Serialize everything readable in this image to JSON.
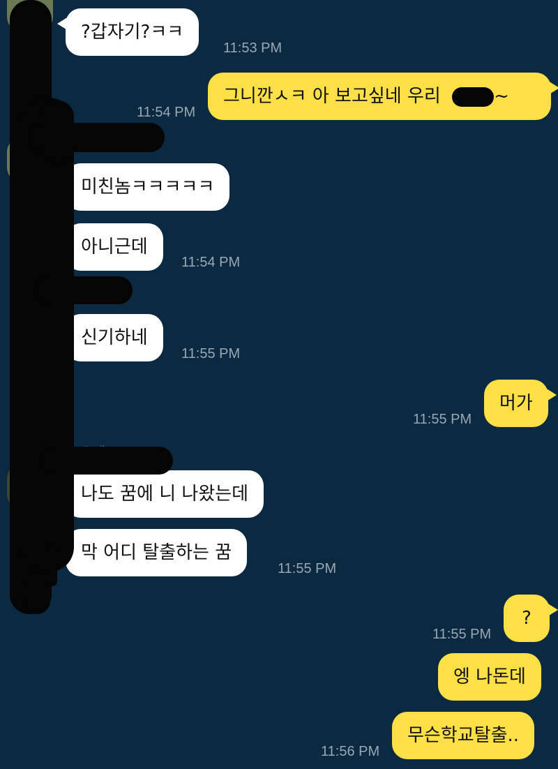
{
  "chat": {
    "messages": [
      {
        "side": "in",
        "text": "?갑자기?ㅋㅋ",
        "time": "11:53 PM"
      },
      {
        "side": "out",
        "text": "그니깐ㅅㅋ 아 보고싶네 우리",
        "time": "11:54 PM",
        "suffix": "~"
      },
      {
        "side": "in",
        "text": "미친놈ㅋㅋㅋㅋㅋ",
        "time": ""
      },
      {
        "side": "in",
        "text": "아니근데",
        "time": "11:54 PM"
      },
      {
        "side": "in",
        "text": "신기하네",
        "time": "11:55 PM"
      },
      {
        "side": "out",
        "text": "머가",
        "time": "11:55 PM"
      },
      {
        "side": "in",
        "text": "나도 꿈에 니 나왔는데",
        "time": ""
      },
      {
        "side": "in",
        "text": "막 어디 탈출하는 꿈",
        "time": "11:55 PM"
      },
      {
        "side": "out",
        "text": "?",
        "time": "11:55 PM"
      },
      {
        "side": "out",
        "text": "엥 나돈데",
        "time": ""
      },
      {
        "side": "out",
        "text": "무슨학교탈출..",
        "time": "11:56 PM"
      }
    ],
    "ghost_name": "모으데"
  },
  "colors": {
    "background": "#0b2940",
    "incoming_bubble": "#ffffff",
    "outgoing_bubble": "#fde047",
    "timestamp": "#9aa8b5",
    "redaction": "#050505"
  },
  "icons": {
    "avatar": "avatar-icon"
  }
}
